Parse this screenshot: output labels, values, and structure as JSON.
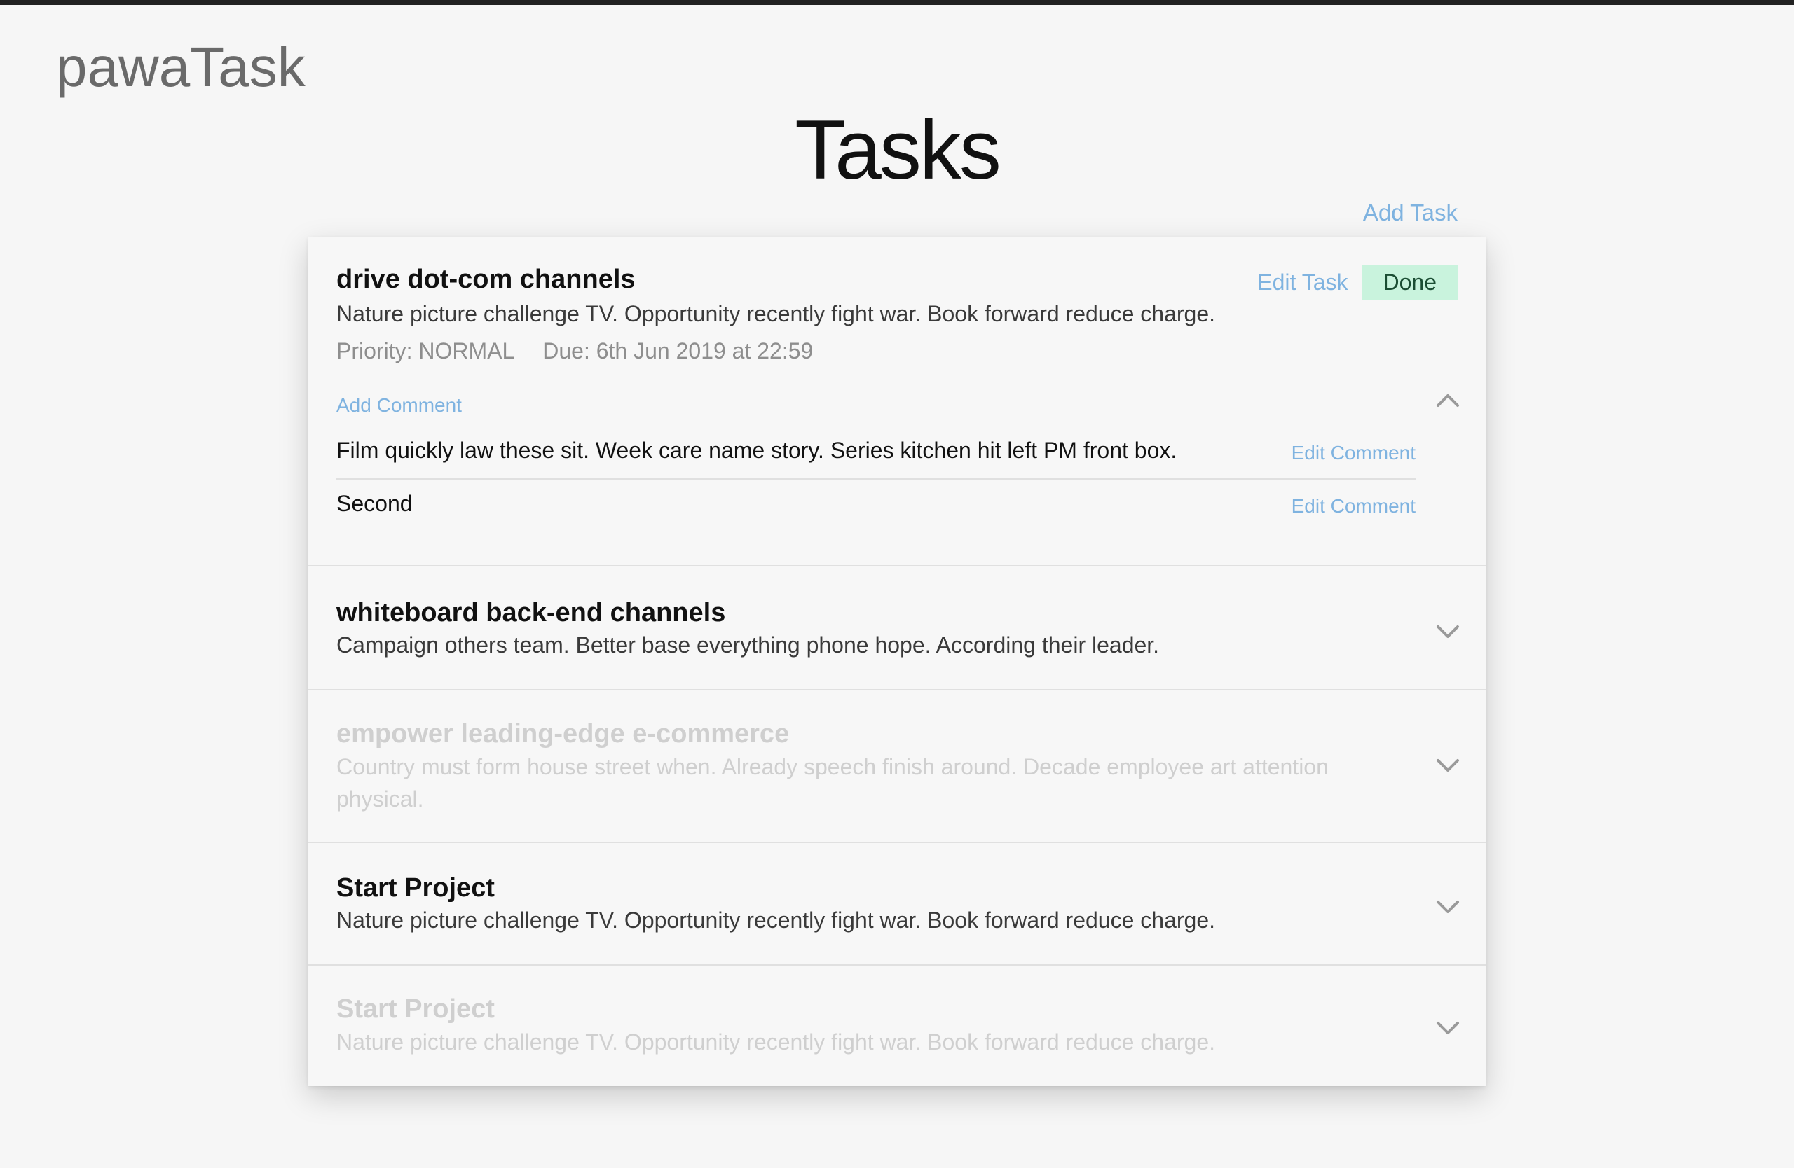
{
  "app": {
    "logo": "pawaTask",
    "page_title": "Tasks",
    "add_task_label": "Add Task"
  },
  "icons": {
    "collapse": "chevron-up-icon",
    "expand": "chevron-down-icon"
  },
  "colors": {
    "link": "#7fb3e0",
    "done_button_bg": "#c9f3dd",
    "muted_text": "#cfcfcf"
  },
  "tasks": [
    {
      "title": "drive dot-com channels",
      "description": "Nature picture challenge TV. Opportunity recently fight war. Book forward reduce charge.",
      "priority": "Priority: NORMAL",
      "due": "Due: 6th Jun 2019 at 22:59",
      "edit_label": "Edit Task",
      "done_label": "Done",
      "add_comment_label": "Add Comment",
      "expanded": true,
      "completed": false,
      "comments": [
        {
          "text": "Film quickly law these sit. Week care name story. Series kitchen hit left PM front box.",
          "edit_label": "Edit Comment"
        },
        {
          "text": "Second",
          "edit_label": "Edit Comment"
        }
      ]
    },
    {
      "title": "whiteboard back-end channels",
      "description": "Campaign others team. Better base everything phone hope. According their leader.",
      "expanded": false,
      "completed": false
    },
    {
      "title": "empower leading-edge e-commerce",
      "description": "Country must form house street when. Already speech finish around. Decade employee art attention physical.",
      "expanded": false,
      "completed": true
    },
    {
      "title": "Start Project",
      "description": "Nature picture challenge TV. Opportunity recently fight war. Book forward reduce charge.",
      "expanded": false,
      "completed": false
    },
    {
      "title": "Start Project",
      "description": "Nature picture challenge TV. Opportunity recently fight war. Book forward reduce charge.",
      "expanded": false,
      "completed": true
    }
  ]
}
